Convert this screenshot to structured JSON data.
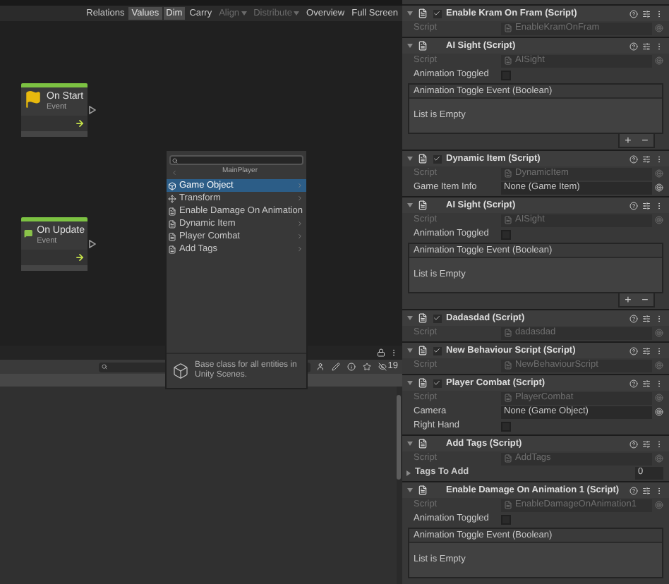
{
  "graph_toolbar": {
    "buttons": [
      {
        "label": "Relations",
        "selected": false,
        "disabled": false,
        "dropdown": false
      },
      {
        "label": "Values",
        "selected": true,
        "disabled": false,
        "dropdown": false
      },
      {
        "label": "Dim",
        "selected": true,
        "disabled": false,
        "dropdown": false
      },
      {
        "label": "Carry",
        "selected": false,
        "disabled": false,
        "dropdown": false
      },
      {
        "label": "Align",
        "selected": false,
        "disabled": true,
        "dropdown": true
      },
      {
        "label": "Distribute",
        "selected": false,
        "disabled": true,
        "dropdown": true
      },
      {
        "label": "Overview",
        "selected": false,
        "disabled": false,
        "dropdown": false
      },
      {
        "label": "Full Screen",
        "selected": false,
        "disabled": false,
        "dropdown": false
      }
    ]
  },
  "nodes": [
    {
      "title": "On Start",
      "subtitle": "Event",
      "kind": "start"
    },
    {
      "title": "On Update",
      "subtitle": "Event",
      "kind": "update"
    }
  ],
  "fuzzy_finder": {
    "header": "MainPlayer",
    "items": [
      {
        "label": "Game Object",
        "kind": "gameobject",
        "selected": true
      },
      {
        "label": "Transform",
        "kind": "transform",
        "selected": false
      },
      {
        "label": "Enable Damage On Animation",
        "kind": "script",
        "selected": false
      },
      {
        "label": "Dynamic Item",
        "kind": "script",
        "selected": false
      },
      {
        "label": "Player Combat",
        "kind": "script",
        "selected": false
      },
      {
        "label": "Add Tags",
        "kind": "script",
        "selected": false
      }
    ],
    "description": "Base class for all entities in Unity Scenes."
  },
  "console_toolbar": {
    "hidden_count": "19"
  },
  "inspector": {
    "components": [
      {
        "title": "Enable Kram On Fram (Script)",
        "checkbox": true,
        "fields": [
          {
            "kind": "script",
            "label": "Script",
            "value": "EnableKramOnFram"
          }
        ]
      },
      {
        "title": "AI Sight (Script)",
        "checkbox": false,
        "fields": [
          {
            "kind": "script",
            "label": "Script",
            "value": "AISight"
          },
          {
            "kind": "toggle",
            "label": "Animation Toggled",
            "checked": false
          },
          {
            "kind": "event",
            "title": "Animation Toggle Event (Boolean)",
            "empty_text": "List is Empty",
            "add": "+",
            "remove": "−"
          }
        ]
      },
      {
        "title": "Dynamic Item (Script)",
        "checkbox": true,
        "fields": [
          {
            "kind": "script",
            "label": "Script",
            "value": "DynamicItem"
          },
          {
            "kind": "object",
            "label": "Game Item Info",
            "value": "None (Game Item)"
          }
        ]
      },
      {
        "title": "AI Sight (Script)",
        "checkbox": false,
        "fields": [
          {
            "kind": "script",
            "label": "Script",
            "value": "AISight"
          },
          {
            "kind": "toggle",
            "label": "Animation Toggled",
            "checked": false
          },
          {
            "kind": "event",
            "title": "Animation Toggle Event (Boolean)",
            "empty_text": "List is Empty",
            "add": "+",
            "remove": "−"
          }
        ]
      },
      {
        "title": "Dadasdad (Script)",
        "checkbox": true,
        "fields": [
          {
            "kind": "script",
            "label": "Script",
            "value": "dadasdad"
          }
        ]
      },
      {
        "title": "New Behaviour Script (Script)",
        "checkbox": true,
        "fields": [
          {
            "kind": "script",
            "label": "Script",
            "value": "NewBehaviourScript"
          }
        ]
      },
      {
        "title": "Player Combat (Script)",
        "checkbox": true,
        "fields": [
          {
            "kind": "script",
            "label": "Script",
            "value": "PlayerCombat"
          },
          {
            "kind": "object",
            "label": "Camera",
            "value": "None (Game Object)"
          },
          {
            "kind": "toggle",
            "label": "Right Hand",
            "checked": false
          }
        ]
      },
      {
        "title": "Add Tags (Script)",
        "checkbox": false,
        "fields": [
          {
            "kind": "script",
            "label": "Script",
            "value": "AddTags"
          },
          {
            "kind": "array",
            "label": "Tags To Add",
            "value": "0",
            "expanded": false
          }
        ]
      },
      {
        "title": "Enable Damage On Animation 1 (Script)",
        "checkbox": false,
        "fields": [
          {
            "kind": "script",
            "label": "Script",
            "value": "EnableDamageOnAnimation1"
          },
          {
            "kind": "toggle",
            "label": "Animation Toggled",
            "checked": false
          },
          {
            "kind": "event",
            "title": "Animation Toggle Event (Boolean)",
            "empty_text": "List is Empty"
          }
        ]
      }
    ]
  }
}
